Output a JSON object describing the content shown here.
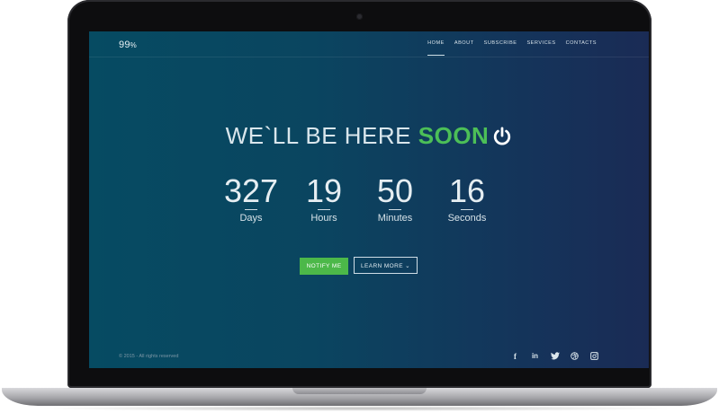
{
  "brand": {
    "name": "99",
    "suffix": "%"
  },
  "nav": {
    "items": [
      "HOME",
      "ABOUT",
      "SUBSCRIBE",
      "SERVICES",
      "CONTACTS"
    ],
    "active_index": 0
  },
  "hero": {
    "headline": "WE`LL BE HERE ",
    "headline_highlight": "SOON"
  },
  "countdown": [
    {
      "value": "327",
      "label": "Days"
    },
    {
      "value": "19",
      "label": "Hours"
    },
    {
      "value": "50",
      "label": "Minutes"
    },
    {
      "value": "16",
      "label": "Seconds"
    }
  ],
  "buttons": {
    "notify": "NOTIFY ME",
    "learn_more": "LEARN MORE ⌄"
  },
  "footer": {
    "copyright": "© 2015 - All rights reserved"
  },
  "social": [
    "facebook-icon",
    "linkedin-icon",
    "twitter-icon",
    "dribbble-icon",
    "instagram-icon"
  ],
  "colors": {
    "accent": "#4cb849",
    "bg_left": "#064b62",
    "bg_right": "#1a2b55"
  }
}
